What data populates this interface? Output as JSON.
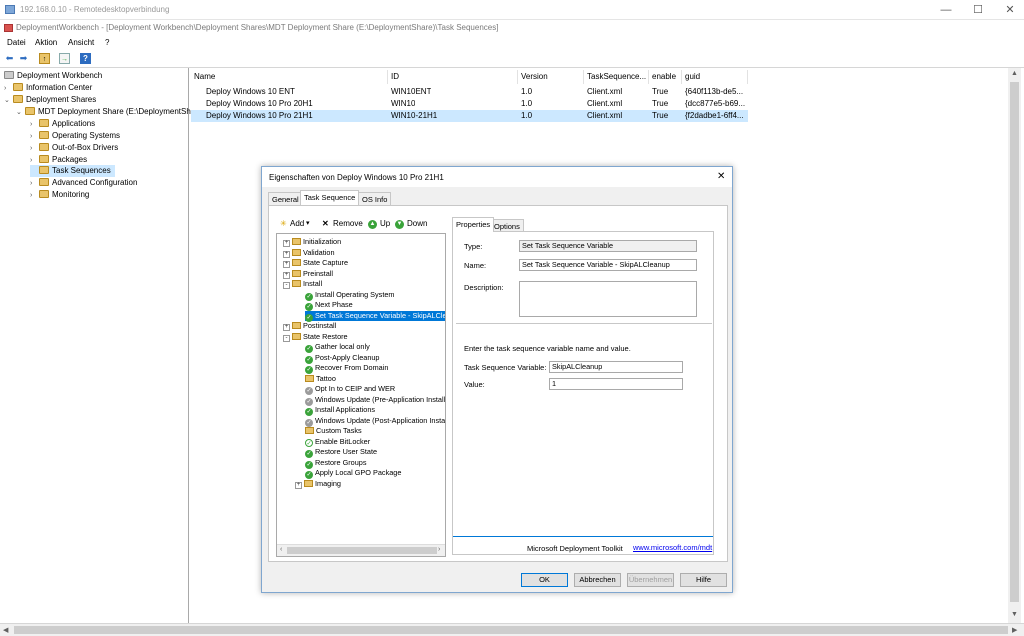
{
  "rdp": {
    "title": "192.168.0.10 - Remotedesktopverbindung"
  },
  "app": {
    "title": "DeploymentWorkbench - [Deployment Workbench\\Deployment Shares\\MDT Deployment Share (E:\\DeploymentShare)\\Task Sequences]"
  },
  "menu": [
    "Datei",
    "Aktion",
    "Ansicht",
    "?"
  ],
  "tree": {
    "root": "Deployment Workbench",
    "info": "Information Center",
    "shares": "Deployment Shares",
    "share": "MDT Deployment Share (E:\\DeploymentSh",
    "children": [
      "Applications",
      "Operating Systems",
      "Out-of-Box Drivers",
      "Packages",
      "Task Sequences",
      "Advanced Configuration",
      "Monitoring"
    ]
  },
  "list": {
    "headers": [
      "Name",
      "ID",
      "Version",
      "TaskSequence...",
      "enable",
      "guid"
    ],
    "rows": [
      [
        "Deploy Windows 10 ENT",
        "WIN10ENT",
        "1.0",
        "Client.xml",
        "True",
        "{640f113b-de5..."
      ],
      [
        "Deploy Windows 10 Pro 20H1",
        "WIN10",
        "1.0",
        "Client.xml",
        "True",
        "{dcc877e5-b69..."
      ],
      [
        "Deploy Windows 10 Pro 21H1",
        "WIN10-21H1",
        "1.0",
        "Client.xml",
        "True",
        "{f2dadbe1-6ff4..."
      ]
    ]
  },
  "dialog": {
    "title": "Eigenschaften von Deploy Windows 10 Pro 21H1",
    "tabs": [
      "General",
      "Task Sequence",
      "OS Info"
    ],
    "toolbar": {
      "add": "Add",
      "remove": "Remove",
      "up": "Up",
      "down": "Down"
    },
    "steps": [
      "Initialization",
      "Validation",
      "State Capture",
      "Preinstall",
      "Install",
      "Install Operating System",
      "Next Phase",
      "Set Task Sequence Variable - SkipALCle",
      "Postinstall",
      "State Restore",
      "Gather local only",
      "Post-Apply Cleanup",
      "Recover From Domain",
      "Tattoo",
      "Opt In to CEIP and WER",
      "Windows Update (Pre-Application Installa",
      "Install Applications",
      "Windows Update (Post-Application Install",
      "Custom Tasks",
      "Enable BitLocker",
      "Restore User State",
      "Restore Groups",
      "Apply Local GPO Package",
      "Imaging"
    ],
    "prop_tabs": [
      "Properties",
      "Options"
    ],
    "type_label": "Type:",
    "type_value": "Set Task Sequence Variable",
    "name_label": "Name:",
    "name_value": "Set Task Sequence Variable - SkipALCleanup",
    "desc_label": "Description:",
    "instruction": "Enter the task sequence variable name and value.",
    "var_label": "Task Sequence Variable:",
    "var_value": "SkipALCleanup",
    "value_label": "Value:",
    "value_value": "1",
    "footer": "Microsoft Deployment Toolkit",
    "link": "www.microsoft.com/mdt",
    "buttons": [
      "OK",
      "Abbrechen",
      "Übernehmen",
      "Hilfe"
    ]
  },
  "colors": {
    "selection": "#cce8ff",
    "accent": "#0078d7",
    "folder": "#e9c46a",
    "check": "#3aa33a"
  }
}
